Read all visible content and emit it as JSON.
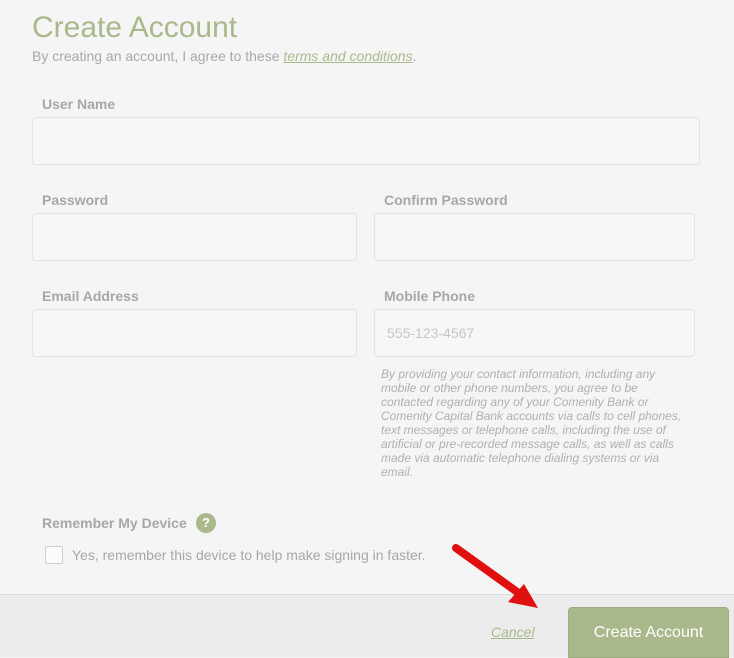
{
  "header": {
    "title": "Create Account",
    "subtitle_prefix": "By creating an account, I agree to these ",
    "terms_link": "terms and conditions",
    "subtitle_suffix": "."
  },
  "form": {
    "username": {
      "label": "User Name",
      "value": ""
    },
    "password": {
      "label": "Password",
      "value": ""
    },
    "confirm_password": {
      "label": "Confirm Password",
      "value": ""
    },
    "email": {
      "label": "Email Address",
      "value": ""
    },
    "mobile": {
      "label": "Mobile Phone",
      "value": "",
      "placeholder": "555-123-4567"
    },
    "disclaimer": "By providing your contact information, including any mobile or other phone numbers, you agree to be contacted regarding any of your Comenity Bank or Comenity Capital Bank accounts via calls to cell phones, text messages or telephone calls, including the use of artificial or pre-recorded message calls, as well as calls made via automatic telephone dialing systems or via email."
  },
  "remember": {
    "label": "Remember My Device",
    "help_icon": "question-circle-icon",
    "help_glyph": "?",
    "checkbox_label": "Yes, remember this device to help make signing in faster.",
    "checked": false
  },
  "footer": {
    "cancel_label": "Cancel",
    "submit_label": "Create Account"
  },
  "colors": {
    "accent": "#a9b98b",
    "annotation_arrow": "#e01010"
  }
}
